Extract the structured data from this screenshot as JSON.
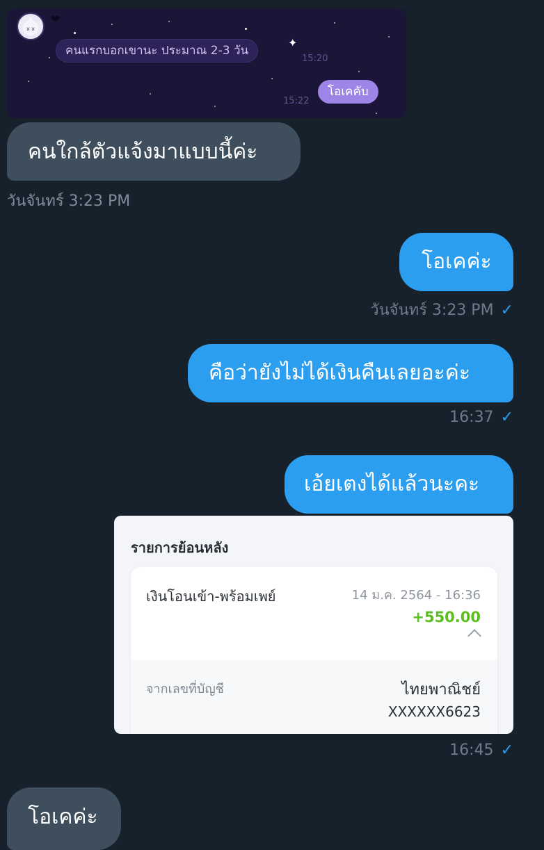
{
  "embedded_image": {
    "message_incoming": "คนแรกบอกเขานะ ประมาณ 2-3 วัน",
    "time_incoming": "15:20",
    "message_outgoing": "โอเคคับ",
    "time_outgoing": "15:22"
  },
  "messages": [
    {
      "text": "คนใกล้ตัวแจ้งมาแบบนี้ค่ะ"
    },
    {
      "text": "โอเคค่ะ",
      "time": "วันจันทร์ 3:23 PM"
    },
    {
      "text": "คือว่ายังไม่ได้เงินคืนเลยอะค่ะ",
      "time": "16:37"
    },
    {
      "text": "เอ้ยเตงได้แล้วนะคะ"
    },
    {
      "text": "โอเคค่ะ"
    }
  ],
  "date_label": "วันจันทร์ 3:23 PM",
  "transaction": {
    "header": "รายการย้อนหลัง",
    "type": "เงินโอนเข้า-พร้อมเพย์",
    "date": "14 ม.ค. 2564 - 16:36",
    "amount": "+550.00",
    "from_label": "จากเลขที่บัญชี",
    "bank": "ไทยพาณิชย์",
    "account": "XXXXXX6623",
    "time": "16:45"
  },
  "colors": {
    "background": "#17212b",
    "incoming_bubble": "#3e4e5c",
    "outgoing_bubble": "#2b9ef0",
    "read_tick": "#2b9ef0",
    "amount_green": "#5cbe1e"
  },
  "icons": {
    "read_tick": "✓",
    "sparkle": "✦",
    "heart": "❤"
  }
}
